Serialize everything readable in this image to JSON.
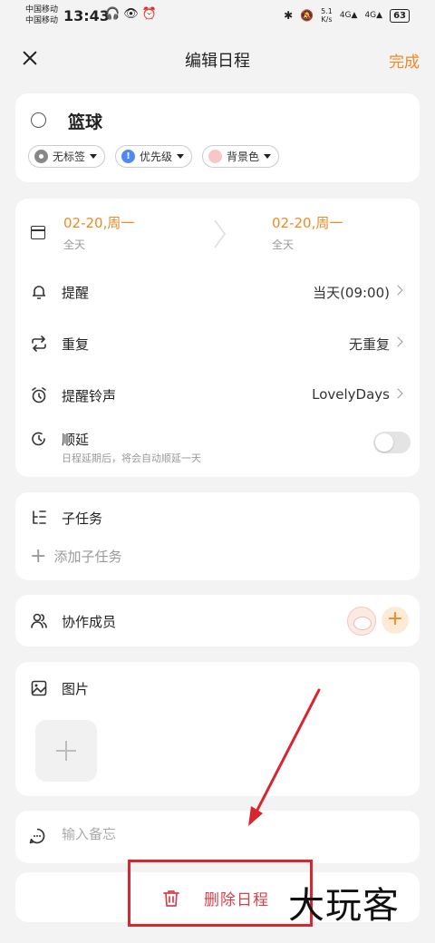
{
  "status_bar": {
    "carrier_1": "中国移动",
    "carrier_2": "中国移动",
    "time": "13:43",
    "net_speed_value": "5.1",
    "net_speed_unit": "K/s",
    "network_1": "4G",
    "network_2": "4G",
    "battery": "63"
  },
  "header": {
    "title": "编辑日程",
    "done_label": "完成"
  },
  "event": {
    "title": "篮球",
    "chips": [
      {
        "label": "无标签"
      },
      {
        "label": "优先级",
        "icon_text": "!"
      },
      {
        "label": "背景色"
      }
    ]
  },
  "schedule": {
    "start_date": "02-20,周一",
    "start_sub": "全天",
    "end_date": "02-20,周一",
    "end_sub": "全天",
    "rows": [
      {
        "label": "提醒",
        "value": "当天(09:00)"
      },
      {
        "label": "重复",
        "value": "无重复"
      },
      {
        "label": "提醒铃声",
        "value": "LovelyDays"
      }
    ],
    "postpone_label": "顺延",
    "postpone_desc": "日程延期后，将会自动顺延一天",
    "postpone_enabled": false
  },
  "subtasks": {
    "label": "子任务",
    "add_label": "添加子任务"
  },
  "members": {
    "label": "协作成员"
  },
  "images": {
    "label": "图片"
  },
  "note": {
    "placeholder": "输入备忘",
    "value": ""
  },
  "delete": {
    "label": "删除日程"
  },
  "overlay": {
    "watermark": "大玩客",
    "accent": "#d8262e"
  },
  "colors": {
    "accent": "#ee8a25",
    "danger": "#d7404a",
    "priority": "#4d89f0",
    "bg_chip": "#f7c7c7"
  }
}
